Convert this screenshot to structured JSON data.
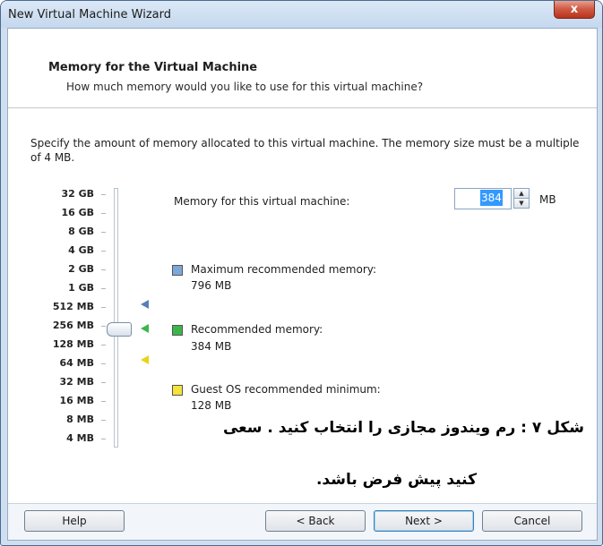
{
  "window": {
    "title": "New Virtual Machine Wizard",
    "close_glyph": "x"
  },
  "header": {
    "title": "Memory for the Virtual Machine",
    "subtitle": "How much memory would you like to use for this virtual machine?"
  },
  "description": "Specify the amount of memory allocated to this virtual machine. The memory size must be a multiple of 4 MB.",
  "scale": [
    "32 GB",
    "16 GB",
    "8 GB",
    "4 GB",
    "2 GB",
    "1 GB",
    "512 MB",
    "256 MB",
    "128 MB",
    "64 MB",
    "32 MB",
    "16 MB",
    "8 MB",
    "4 MB"
  ],
  "memory": {
    "label": "Memory for this virtual machine:",
    "value": "384",
    "unit": "MB"
  },
  "legend": [
    {
      "label": "Maximum recommended memory:",
      "value": "796 MB",
      "color": "#7da7d9"
    },
    {
      "label": "Recommended memory:",
      "value": "384 MB",
      "color": "#3cb54a"
    },
    {
      "label": "Guest OS recommended minimum:",
      "value": "128 MB",
      "color": "#f3e33b"
    }
  ],
  "markers": {
    "max_color": "#5a7fb8",
    "recommended_color": "#3cb54a",
    "minimum_color": "#e8d41a"
  },
  "caption": {
    "line1": "شکل ۷ : رم ویندوز مجازی را انتخاب کنید . سعی",
    "line2": "کنید پیش فرض باشد."
  },
  "buttons": {
    "help": "Help",
    "back": "< Back",
    "next": "Next >",
    "cancel": "Cancel"
  }
}
